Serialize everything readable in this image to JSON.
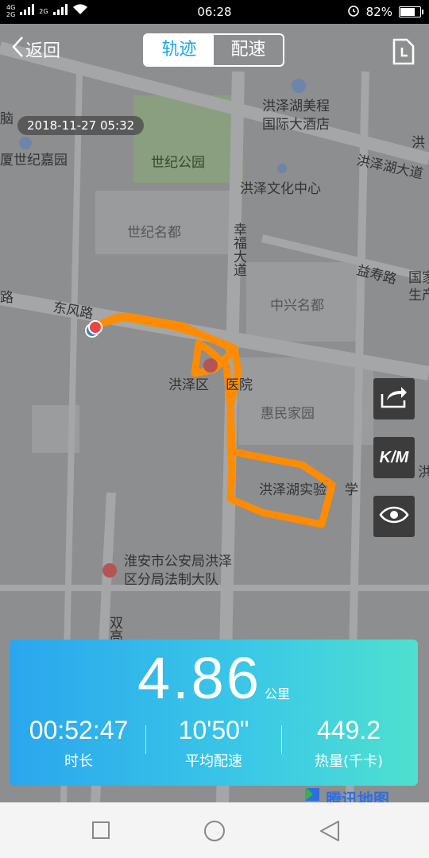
{
  "status_bar": {
    "network": [
      "4G",
      "2G"
    ],
    "network2": "2G",
    "time": "06:28",
    "battery": "82%",
    "battery_level": 0.82
  },
  "header": {
    "back_label": "返回",
    "tabs": [
      {
        "label": "轨迹",
        "active": true
      },
      {
        "label": "配速",
        "active": false
      }
    ],
    "accent_color": "#1aa8ea"
  },
  "map": {
    "date_badge": "2018-11-27 05:32",
    "labels": [
      {
        "text": "洪泽湖美程",
        "name": "hotel-line1"
      },
      {
        "text": "国际大酒店",
        "name": "hotel-line2"
      },
      {
        "text": "世纪公园",
        "name": "park"
      },
      {
        "text": "洪泽湖大道",
        "name": "hongzehu-avenue"
      },
      {
        "text": "洪泽文化中心",
        "name": "culture-center"
      },
      {
        "text": "世纪名都",
        "name": "shiji-mingdu"
      },
      {
        "text": "益寿路",
        "name": "yishou-road"
      },
      {
        "text": "中兴名都",
        "name": "zhongxing-mingdu"
      },
      {
        "text": "东风路",
        "name": "dongfeng-road"
      },
      {
        "text": "洪泽区",
        "name": "hospital-part1"
      },
      {
        "text": "医院",
        "name": "hospital-part2"
      },
      {
        "text": "惠民家园",
        "name": "huimin-jiayuan"
      },
      {
        "text": "洪泽湖实验",
        "name": "school-part1"
      },
      {
        "text": "学",
        "name": "school-part2"
      },
      {
        "text": "淮安市公安局洪泽",
        "name": "police-line1"
      },
      {
        "text": "区分局法制大队",
        "name": "police-line2"
      },
      {
        "text": "厦世纪嘉园",
        "name": "jiayuan"
      },
      {
        "text": "洪",
        "name": "edge-hong"
      },
      {
        "text": "国家",
        "name": "edge-guojia"
      },
      {
        "text": "生产",
        "name": "edge-shengchan"
      },
      {
        "text": "脑",
        "name": "edge-nao"
      },
      {
        "text": "路",
        "name": "edge-lu"
      },
      {
        "text": "洪",
        "name": "edge-hong2"
      }
    ],
    "vertical_labels": [
      {
        "text": "幸福大道",
        "name": "xingfu-avenue"
      },
      {
        "text": "双高路",
        "name": "shuanggao-road"
      }
    ],
    "route_color": "#ff8c00"
  },
  "side_buttons": [
    {
      "name": "share-button",
      "icon": "share-icon"
    },
    {
      "name": "km-toggle-button",
      "icon": "km-icon",
      "label": "K/M"
    },
    {
      "name": "visibility-button",
      "icon": "eye-icon"
    }
  ],
  "summary": {
    "distance": "4.86",
    "distance_unit": "公里",
    "stats": [
      {
        "value": "00:52:47",
        "label": "时长"
      },
      {
        "value": "10'50\"",
        "label": "平均配速"
      },
      {
        "value": "449.2",
        "label": "热量(千卡)"
      }
    ]
  },
  "map_logo": "腾讯地图",
  "nav_bar": [
    "recent-apps",
    "home",
    "back"
  ]
}
